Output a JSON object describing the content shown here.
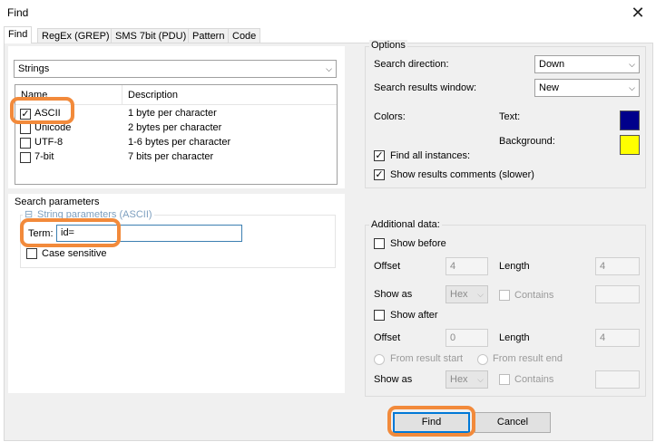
{
  "window": {
    "title": "Find",
    "close_glyph": "✕"
  },
  "tabs": [
    {
      "label": "Find",
      "active": true
    },
    {
      "label": "RegEx (GREP)",
      "active": false
    },
    {
      "label": "SMS 7bit (PDU)",
      "active": false
    },
    {
      "label": "Pattern",
      "active": false
    },
    {
      "label": "Code",
      "active": false
    }
  ],
  "left": {
    "search_type": {
      "selected": "Strings"
    },
    "list": {
      "columns": {
        "name": "Name",
        "description": "Description"
      },
      "rows": [
        {
          "name": "ASCII",
          "description": "1 byte per character",
          "checked": true
        },
        {
          "name": "Unicode",
          "description": "2 bytes per character",
          "checked": false
        },
        {
          "name": "UTF-8",
          "description": "1-6 bytes per character",
          "checked": false
        },
        {
          "name": "7-bit",
          "description": "7 bits per character",
          "checked": false
        }
      ]
    },
    "search_parameters": {
      "title": "Search parameters",
      "string_params_title": "String parameters (ASCII)",
      "collapse_glyph": "⊟",
      "term_label": "Term:",
      "term_value": "id=",
      "case_sensitive_label": "Case sensitive",
      "case_sensitive_checked": false
    }
  },
  "options": {
    "title": "Options",
    "search_direction_label": "Search direction:",
    "search_direction_value": "Down",
    "results_window_label": "Search results window:",
    "results_window_value": "New",
    "colors_label": "Colors:",
    "text_label": "Text:",
    "text_color": "#00008b",
    "background_label": "Background:",
    "background_color": "#ffff00",
    "find_all_label": "Find all instances:",
    "find_all_checked": true,
    "show_comments_label": "Show results comments (slower)",
    "show_comments_checked": true
  },
  "additional": {
    "title": "Additional data:",
    "show_before_label": "Show before",
    "offset_label": "Offset",
    "before_offset": "4",
    "length_label": "Length",
    "before_length": "4",
    "show_as_label": "Show as",
    "before_show_as": "Hex",
    "contains_label": "Contains",
    "show_after_label": "Show after",
    "after_offset": "0",
    "after_length": "4",
    "from_start_label": "From  result start",
    "from_end_label": "From  result end",
    "after_show_as": "Hex"
  },
  "buttons": {
    "find": "Find",
    "cancel": "Cancel"
  },
  "accent": {
    "highlight": "#f28a3b",
    "focus": "#0078d7"
  }
}
